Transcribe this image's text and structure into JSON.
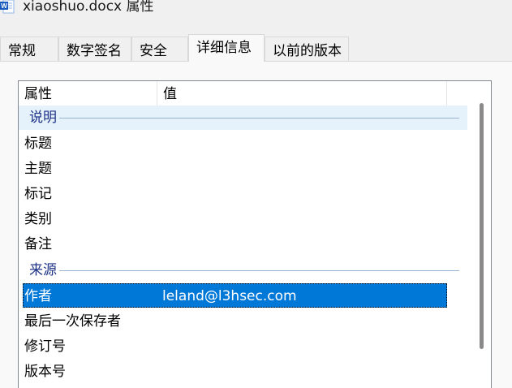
{
  "window": {
    "title": "xiaoshuo.docx 属性",
    "icon": "word-document-icon"
  },
  "tabs": [
    {
      "label": "常规",
      "active": false
    },
    {
      "label": "数字签名",
      "active": false
    },
    {
      "label": "安全",
      "active": false
    },
    {
      "label": "详细信息",
      "active": true
    },
    {
      "label": "以前的版本",
      "active": false
    }
  ],
  "list": {
    "columns": {
      "property": "属性",
      "value": "值"
    },
    "groups": {
      "description": "说明",
      "origin": "来源"
    },
    "description_rows": [
      {
        "name": "标题",
        "value": ""
      },
      {
        "name": "主题",
        "value": ""
      },
      {
        "name": "标记",
        "value": ""
      },
      {
        "name": "类别",
        "value": ""
      },
      {
        "name": "备注",
        "value": ""
      }
    ],
    "origin_rows": [
      {
        "name": "作者",
        "value": "leland@l3hsec.com",
        "selected": true
      },
      {
        "name": "最后一次保存者",
        "value": ""
      },
      {
        "name": "修订号",
        "value": ""
      },
      {
        "name": "版本号",
        "value": ""
      }
    ]
  },
  "colors": {
    "selection": "#0078d7",
    "group_header_text": "#1e3287",
    "group_hover": "#e5f1fb"
  }
}
